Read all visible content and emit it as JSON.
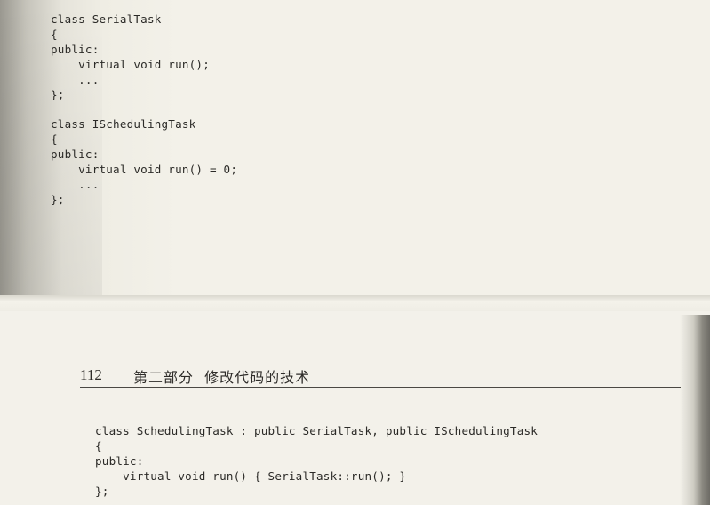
{
  "top_page": {
    "code_serial": [
      "class SerialTask",
      "{",
      "public:",
      "    virtual void run();",
      "    ...",
      "};"
    ],
    "code_ischeduling": [
      "class ISchedulingTask",
      "{",
      "public:",
      "    virtual void run() = 0;",
      "    ...",
      "};"
    ]
  },
  "bottom_page": {
    "page_number": "112",
    "chapter_title": "第二部分  修改代码的技术",
    "code_scheduling": [
      "class SchedulingTask : public SerialTask, public ISchedulingTask",
      "{",
      "public:",
      "    virtual void run() { SerialTask::run(); }",
      "};"
    ]
  }
}
